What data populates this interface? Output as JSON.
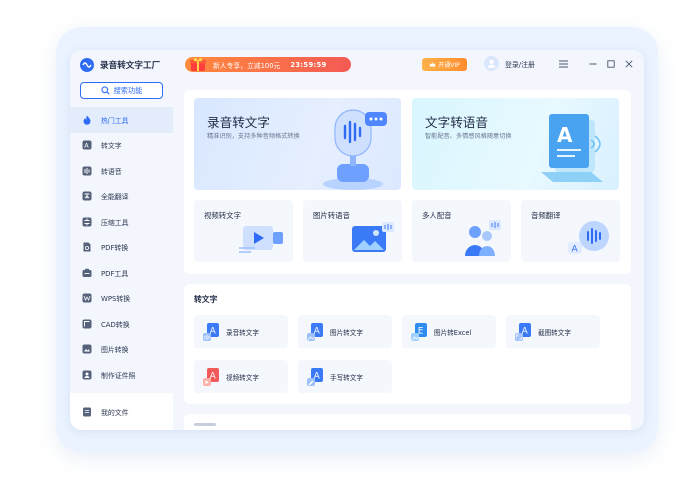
{
  "app": {
    "name": "录音转文字工厂"
  },
  "sidebar": {
    "search_label": "搜索功能",
    "items": [
      {
        "label": "热门工具",
        "icon": "fire-icon",
        "active": true
      },
      {
        "label": "转文字",
        "icon": "to-text-icon"
      },
      {
        "label": "转语音",
        "icon": "to-voice-icon"
      },
      {
        "label": "全能翻译",
        "icon": "translate-icon"
      },
      {
        "label": "压缩工具",
        "icon": "compress-icon"
      },
      {
        "label": "PDF转换",
        "icon": "pdf-convert-icon"
      },
      {
        "label": "PDF工具",
        "icon": "pdf-tools-icon"
      },
      {
        "label": "WPS转换",
        "icon": "wps-icon"
      },
      {
        "label": "CAD转换",
        "icon": "cad-icon"
      },
      {
        "label": "图片转换",
        "icon": "image-icon"
      },
      {
        "label": "制作证件照",
        "icon": "id-photo-icon"
      }
    ],
    "my_files": "我的文件"
  },
  "header": {
    "promo_text": "新人专享，立减100元",
    "promo_timer": "23:59:59",
    "vip_label": "开通VIP",
    "login_label": "登录/注册"
  },
  "hot": {
    "heroes": [
      {
        "title": "录音转文字",
        "subtitle": "精准识别，支持多种音频格式转换"
      },
      {
        "title": "文字转语音",
        "subtitle": "智能配音、多情感风格随意切换"
      }
    ],
    "tiles": [
      {
        "label": "视频转文字"
      },
      {
        "label": "图片转语音"
      },
      {
        "label": "多人配音"
      },
      {
        "label": "音频翻译"
      }
    ]
  },
  "to_text": {
    "title": "转文字",
    "items": [
      {
        "label": "录音转文字"
      },
      {
        "label": "图片转文字"
      },
      {
        "label": "图片转Excel"
      },
      {
        "label": "截图转文字"
      },
      {
        "label": "视频转文字"
      },
      {
        "label": "手写转文字"
      }
    ]
  },
  "colors": {
    "accent": "#2f6cf6",
    "promo": "#f45a54",
    "vip": "#ff9b3a"
  }
}
